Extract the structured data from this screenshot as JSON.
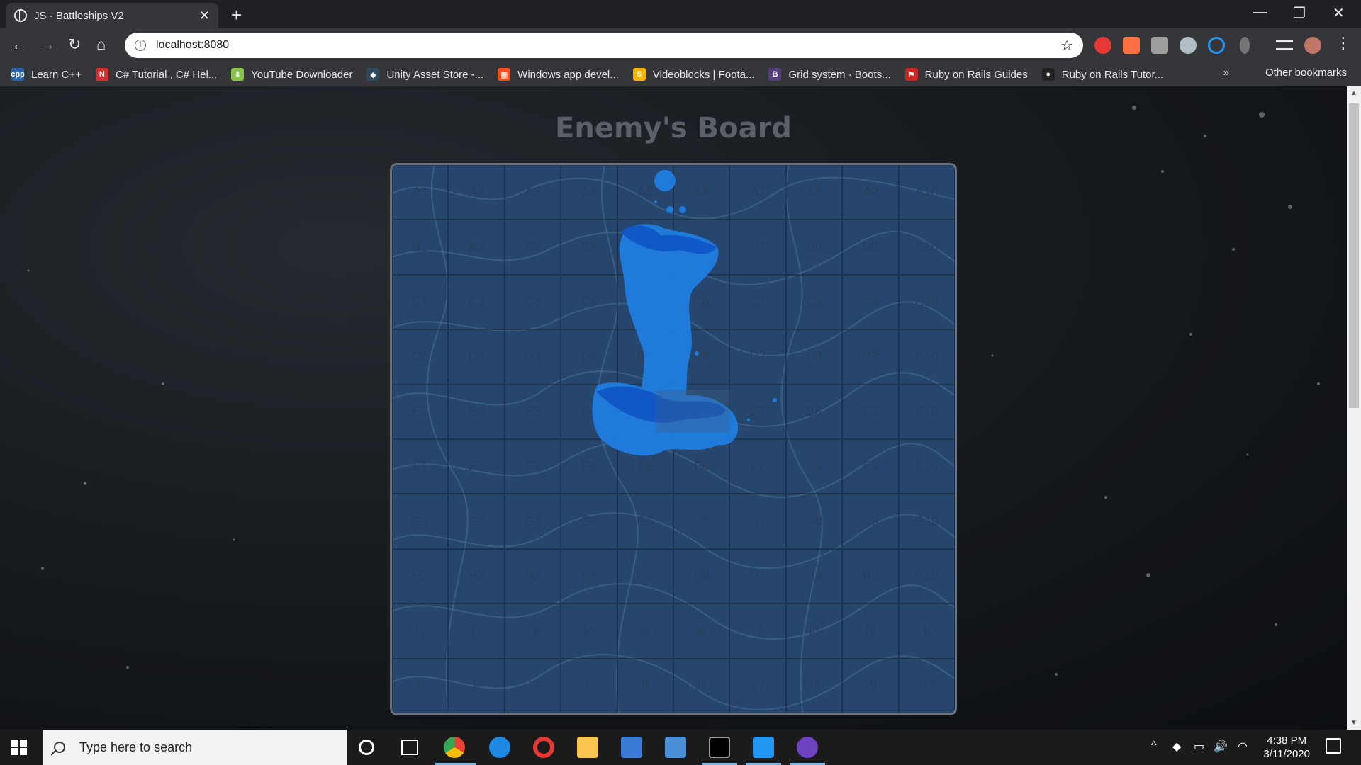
{
  "browser": {
    "tab_title": "JS - Battleships V2",
    "tab_close": "✕",
    "new_tab": "+",
    "url": "localhost:8080",
    "minimize": "—",
    "maximize": "❐",
    "close": "✕",
    "back": "←",
    "forward": "→",
    "reload": "↻",
    "home": "⌂",
    "star": "☆",
    "menu": "⋮"
  },
  "bookmarks": [
    {
      "label": "Learn C++",
      "icon": "cpp-icon",
      "icon_text": "cpp",
      "color": "#2a62a8"
    },
    {
      "label": "C# Tutorial , C# Hel...",
      "icon": "n-icon",
      "icon_text": "N",
      "color": "#d32f2f"
    },
    {
      "label": "YouTube Downloader",
      "icon": "download-icon",
      "icon_text": "⬇",
      "color": "#8bc34a"
    },
    {
      "label": "Unity Asset Store -...",
      "icon": "unity-icon",
      "icon_text": "◆",
      "color": "#2f4a5a"
    },
    {
      "label": "Windows app devel...",
      "icon": "windows-icon",
      "icon_text": "▦",
      "color": "#f25022"
    },
    {
      "label": "Videoblocks | Foota...",
      "icon": "videoblocks-icon",
      "icon_text": "$",
      "color": "#f4b400"
    },
    {
      "label": "Grid system · Boots...",
      "icon": "bootstrap-icon",
      "icon_text": "B",
      "color": "#563d7c"
    },
    {
      "label": "Ruby on Rails Guides",
      "icon": "rails-icon",
      "icon_text": "⚑",
      "color": "#c62828"
    },
    {
      "label": "Ruby on Rails Tutor...",
      "icon": "rails-tutorial-icon",
      "icon_text": "●",
      "color": "#222222"
    }
  ],
  "bookmarks_overflow": "»",
  "other_bookmarks": "Other bookmarks",
  "page": {
    "title": "Enemy's Board"
  },
  "board": {
    "rows": [
      "A",
      "B",
      "C",
      "D",
      "E",
      "F",
      "G",
      "H",
      "I",
      "J"
    ],
    "columns": [
      "1",
      "2",
      "3",
      "4",
      "5",
      "6",
      "7",
      "8",
      "9",
      "10"
    ]
  },
  "taskbar": {
    "search_placeholder": "Type here to search",
    "time": "4:38 PM",
    "date": "3/11/2020",
    "tray_chevron": "^",
    "volume": "🔊"
  }
}
